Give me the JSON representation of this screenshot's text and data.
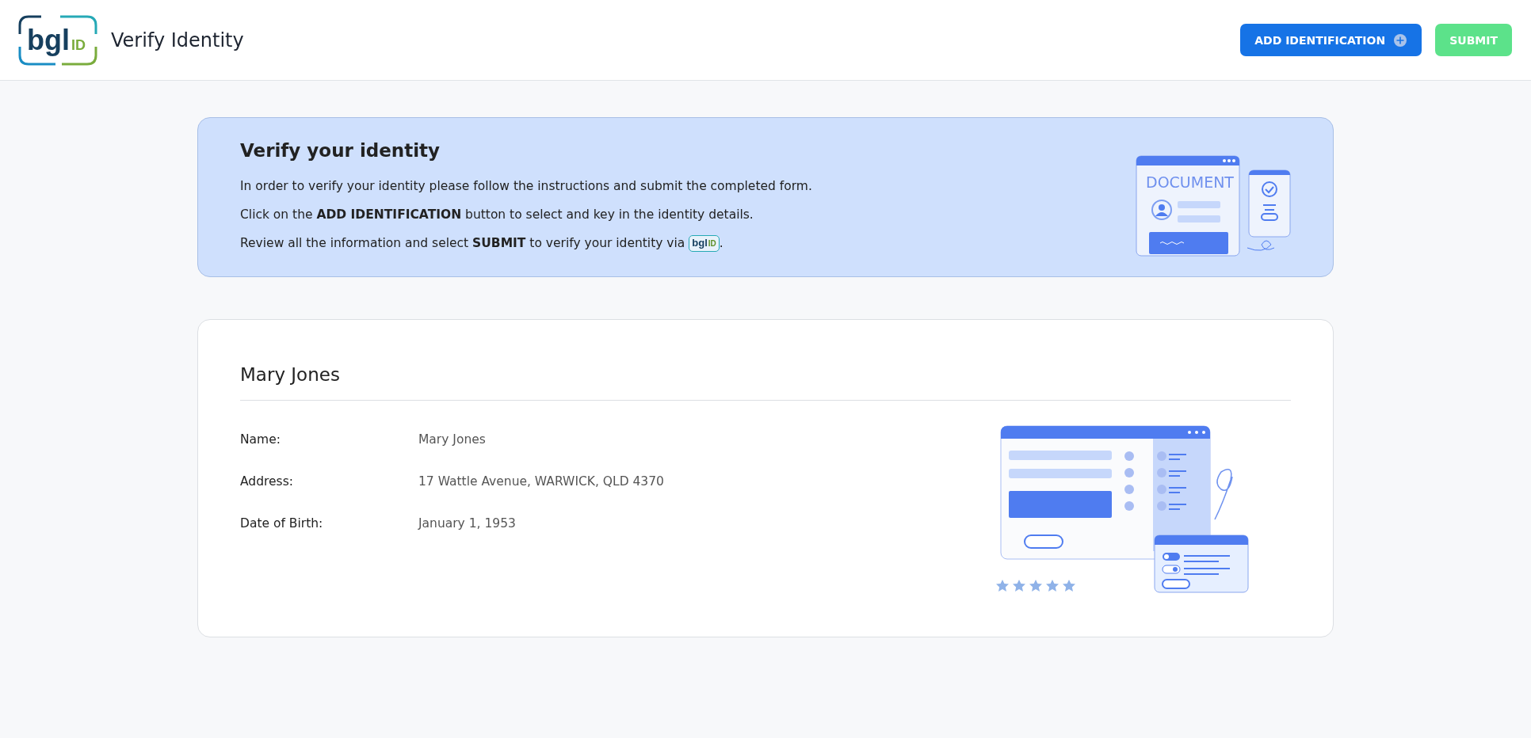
{
  "header": {
    "logo": {
      "main": "bgl",
      "suffix": "ID"
    },
    "title": "Verify Identity",
    "buttons": [
      {
        "kind": "primary",
        "label": "ADD IDENTIFICATION"
      },
      {
        "kind": "success",
        "label": "SUBMIT"
      }
    ]
  },
  "banner": {
    "heading": "Verify your identity",
    "lines": [
      "In order to verify your identity please follow the instructions and submit the completed form.",
      "Click on the **ADD IDENTIFICATION** button to select and key in the identity details.",
      "Review all the information and select **SUBMIT** to verify your identity via"
    ],
    "inline_logo": {
      "main": "bgl",
      "suffix": "ID"
    },
    "trailing": ".",
    "illustration_label": "DOCUMENT"
  },
  "card": {
    "heading": "Mary Jones",
    "fields": [
      {
        "label": "Name:",
        "value": "Mary Jones"
      },
      {
        "label": "Address:",
        "value": "17 Wattle Avenue, WARWICK, QLD 4370"
      },
      {
        "label": "Date of Birth:",
        "value": "January 1, 1953"
      }
    ]
  }
}
